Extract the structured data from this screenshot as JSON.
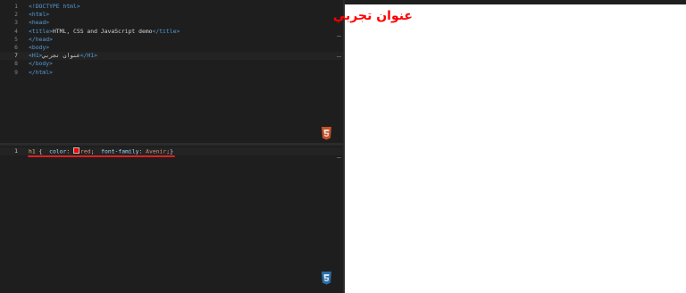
{
  "html_editor": {
    "lines": [
      {
        "num": "1",
        "parts": [
          {
            "cls": "doctype",
            "text": "<!DOCTYPE html>"
          }
        ]
      },
      {
        "num": "2",
        "parts": [
          {
            "cls": "tag",
            "text": "<html>"
          }
        ]
      },
      {
        "num": "3",
        "parts": [
          {
            "cls": "tag",
            "text": "<head>"
          }
        ]
      },
      {
        "num": "4",
        "parts": [
          {
            "cls": "tag",
            "text": "<title>"
          },
          {
            "cls": "txt",
            "text": "HTML, CSS and JavaScript demo"
          },
          {
            "cls": "tag",
            "text": "</title>"
          }
        ]
      },
      {
        "num": "5",
        "parts": [
          {
            "cls": "tag",
            "text": "</head>"
          }
        ]
      },
      {
        "num": "6",
        "parts": [
          {
            "cls": "tag",
            "text": "<body>"
          }
        ]
      },
      {
        "num": "7",
        "parts": [
          {
            "cls": "tag",
            "text": "<H1>"
          },
          {
            "cls": "txt",
            "text": "عنوان تجربي"
          },
          {
            "cls": "tag",
            "text": "</H1>"
          }
        ]
      },
      {
        "num": "8",
        "parts": [
          {
            "cls": "tag",
            "text": "</body>"
          }
        ]
      },
      {
        "num": "9",
        "parts": [
          {
            "cls": "tag",
            "text": "</html>"
          }
        ]
      }
    ],
    "active_line": "7",
    "icon": "html5-icon"
  },
  "css_editor": {
    "lines": [
      {
        "num": "1",
        "parts": [
          {
            "cls": "sel",
            "text": "h1"
          },
          {
            "cls": "punc",
            "text": " {  "
          },
          {
            "cls": "prop",
            "text": "color"
          },
          {
            "cls": "punc",
            "text": ": "
          },
          {
            "cls": "swatch",
            "text": ""
          },
          {
            "cls": "val",
            "text": "red"
          },
          {
            "cls": "punc",
            "text": ";  "
          },
          {
            "cls": "prop",
            "text": "font-family"
          },
          {
            "cls": "punc",
            "text": ": "
          },
          {
            "cls": "val",
            "text": "Avenir"
          },
          {
            "cls": "punc",
            "text": ";}"
          }
        ]
      }
    ],
    "active_line": "1",
    "icon": "css3-icon",
    "swatch_color": "#ff0000"
  },
  "preview": {
    "heading": "عنوان تجربي",
    "heading_color": "#ff0000"
  }
}
